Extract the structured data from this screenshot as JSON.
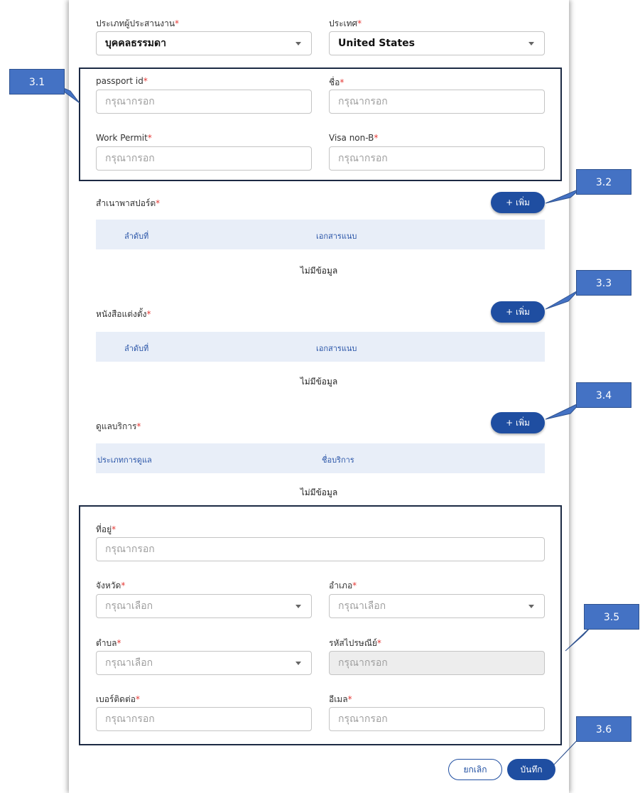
{
  "top": {
    "operator_type_label": "ประเภทผู้ประสานงาน",
    "operator_type_value": "บุคคลธรรมดา",
    "country_label": "ประเทศ",
    "country_value": "United States"
  },
  "identity": {
    "passport_label": "passport id",
    "passport_placeholder": "กรุณากรอก",
    "name_label": "ชื่อ",
    "name_placeholder": "กรุณากรอก",
    "work_permit_label": "Work Permit",
    "work_permit_placeholder": "กรุณากรอก",
    "visa_label": "Visa non-B",
    "visa_placeholder": "กรุณากรอก"
  },
  "passport_copy": {
    "title": "สำเนาพาสปอร์ต",
    "add_label": "+  เพิ่ม",
    "columns": [
      "ลำดับที่",
      "เอกสารแนบ"
    ],
    "empty": "ไม่มีข้อมูล"
  },
  "appointment": {
    "title": "หนังสือแต่งตั้ง",
    "add_label": "+  เพิ่ม",
    "columns": [
      "ลำดับที่",
      "เอกสารแนบ"
    ],
    "empty": "ไม่มีข้อมูล"
  },
  "service_care": {
    "title": "ดูแลบริการ",
    "add_label": "+  เพิ่ม",
    "columns": [
      "ประเภทการดูแล",
      "ชื่อบริการ"
    ],
    "empty": "ไม่มีข้อมูล"
  },
  "address": {
    "address_label": "ที่อยู่",
    "address_placeholder": "กรุณากรอก",
    "province_label": "จังหวัด",
    "province_placeholder": "กรุณาเลือก",
    "district_label": "อำเภอ",
    "district_placeholder": "กรุณาเลือก",
    "subdistrict_label": "ตำบล",
    "subdistrict_placeholder": "กรุณาเลือก",
    "postal_label": "รหัสไปรษณีย์",
    "postal_placeholder": "กรุณากรอก",
    "phone_label": "เบอร์ติดต่อ",
    "phone_placeholder": "กรุณากรอก",
    "email_label": "อีเมล",
    "email_placeholder": "กรุณากรอก"
  },
  "required_mark": "*",
  "footer": {
    "cancel_label": "ยกเลิก",
    "save_label": "บันทึก"
  },
  "callouts": [
    "3.1",
    "3.2",
    "3.3",
    "3.4",
    "3.5",
    "3.6"
  ],
  "colors": {
    "primary": "#1f4ea1",
    "callout": "#4472c4",
    "required": "#e53935",
    "table_header": "#e8eef8"
  }
}
